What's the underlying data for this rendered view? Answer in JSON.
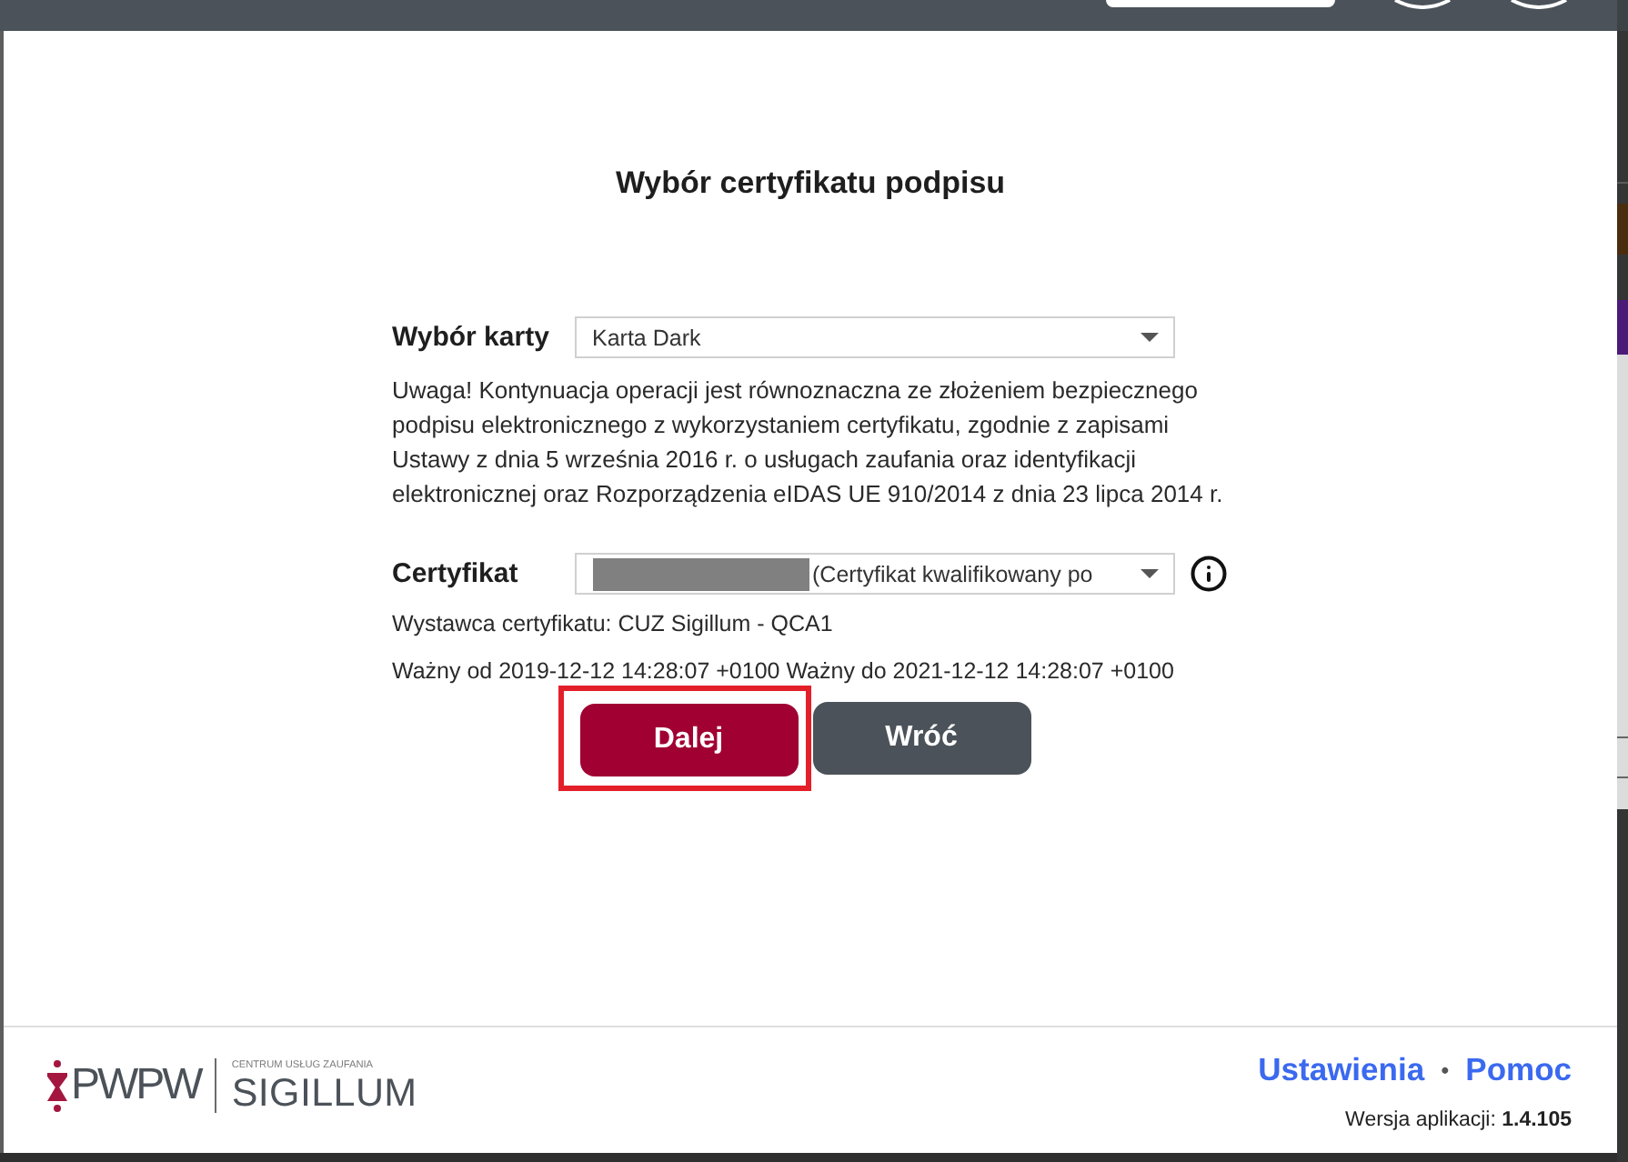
{
  "dialog": {
    "title": "Wybór certyfikatu podpisu"
  },
  "card_field": {
    "label": "Wybór karty",
    "value": "Karta Dark"
  },
  "notice": "Uwaga! Kontynuacja operacji jest równoznaczna ze złożeniem bezpiecznego podpisu elektronicznego z wykorzystaniem certyfikatu, zgodnie z zapisami Ustawy z dnia 5 września 2016 r. o usługach zaufania oraz identyfikacji elektronicznej oraz Rozporządzenia eIDAS UE 910/2014 z dnia 23 lipca 2014 r.",
  "certificate_field": {
    "label": "Certyfikat",
    "value": "(Certyfikat kwalifikowany po",
    "redacted_prefix": true
  },
  "issuer": "Wystawca certyfikatu: CUZ Sigillum - QCA1",
  "validity": "Ważny od 2019-12-12 14:28:07 +0100 Ważny do 2021-12-12 14:28:07 +0100",
  "buttons": [
    {
      "kind": "primary",
      "label": "Dalej",
      "highlighted": true
    },
    {
      "kind": "secondary",
      "label": "Wróć",
      "highlighted": false
    }
  ],
  "footer": {
    "logo": {
      "brand": "PWPW",
      "tagline": "CENTRUM USŁUG ZAUFANIA",
      "product": "SIGILLUM"
    },
    "links": [
      {
        "label": "Ustawienia"
      },
      {
        "label": "Pomoc"
      }
    ],
    "separator": "•",
    "version": "Wersja aplikacji: **1.4.105**"
  }
}
